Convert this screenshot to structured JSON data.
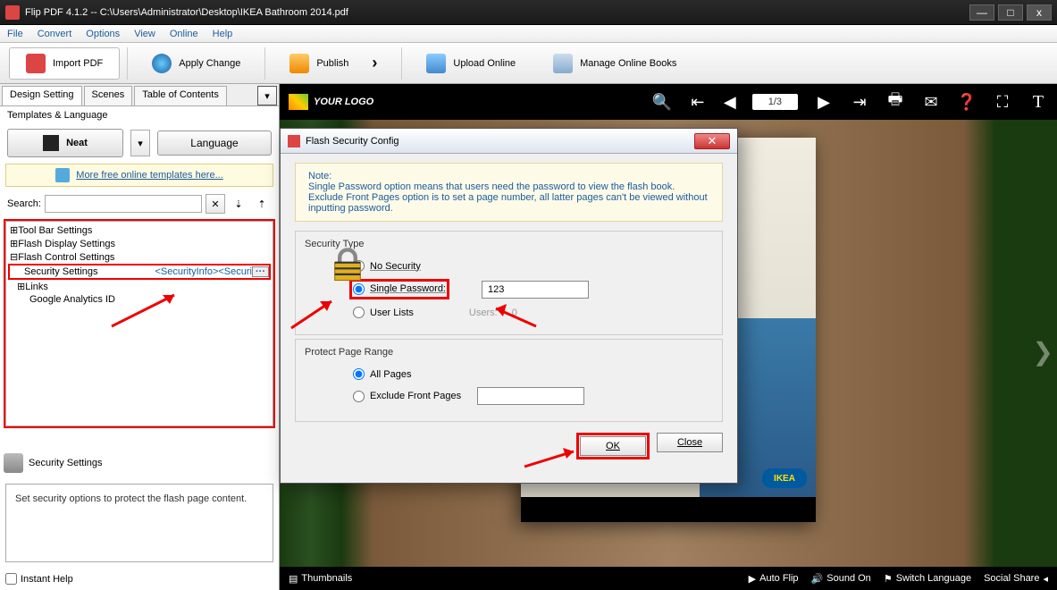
{
  "window": {
    "title": "Flip PDF 4.1.2  -- C:\\Users\\Administrator\\Desktop\\IKEA Bathroom 2014.pdf",
    "minimize": "—",
    "maximize": "□",
    "close": "x"
  },
  "menu": [
    "File",
    "Convert",
    "Options",
    "View",
    "Online",
    "Help"
  ],
  "toolbar": {
    "import": "Import PDF",
    "apply": "Apply Change",
    "publish": "Publish",
    "upload": "Upload Online",
    "manage": "Manage Online Books"
  },
  "leftpanel": {
    "tabs": [
      "Design Setting",
      "Scenes",
      "Table of Contents"
    ],
    "templates_label": "Templates & Language",
    "neat_btn": "Neat",
    "language_btn": "Language",
    "templates_link": "More free online templates here...",
    "search_label": "Search:",
    "tree": {
      "toolbar": "Tool Bar Settings",
      "flashdisplay": "Flash Display Settings",
      "flashcontrol": "Flash Control Settings",
      "security": "Security Settings",
      "security_val": "<SecurityInfo><Securi",
      "links": "Links",
      "ga": "Google Analytics ID"
    },
    "desc": {
      "title": "Security Settings",
      "text": "Set security options to protect the flash page content."
    },
    "instant_help": "Instant Help"
  },
  "viewer": {
    "logo_text": "YOUR LOGO",
    "page_indicator": "1/3",
    "ikea": "IKEA",
    "footer": {
      "thumbnails": "Thumbnails",
      "autoflip": "Auto Flip",
      "sound": "Sound On",
      "lang": "Switch Language",
      "share": "Social Share"
    }
  },
  "dialog": {
    "title": "Flash Security Config",
    "note_label": "Note:",
    "note_body": "Single Password option means that users need the password to view the flash book. Exclude Front Pages option is to set a page number, all latter pages can't be viewed without inputting password.",
    "security_type_label": "Security Type",
    "no_security": "No Security",
    "single_password": "Single Password:",
    "password_value": "123",
    "user_lists": "User Lists",
    "users_label": "Users:",
    "users_count": "0",
    "protect_label": "Protect Page Range",
    "all_pages": "All Pages",
    "exclude_front": "Exclude Front Pages",
    "ok": "OK",
    "close": "Close"
  }
}
